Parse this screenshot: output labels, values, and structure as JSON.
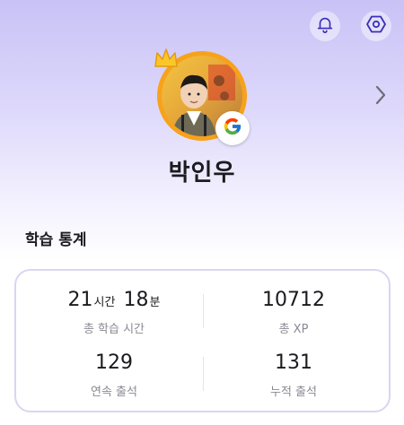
{
  "header": {
    "bell_icon": "bell-icon",
    "settings_icon": "hexagon-settings-icon",
    "next_icon": "chevron-right-icon"
  },
  "profile": {
    "name": "박인우",
    "login_provider_icon": "google-icon",
    "avatar_frame_color": "#f7a21a"
  },
  "stats_section": {
    "title": "학습 통계",
    "total_time": {
      "hours": "21",
      "hours_unit": "시간",
      "minutes": "18",
      "minutes_unit": "분",
      "label": "총 학습 시간"
    },
    "total_xp": {
      "value": "10712",
      "label": "총 XP"
    },
    "streak": {
      "value": "129",
      "label": "연속 출석"
    },
    "attendance": {
      "value": "131",
      "label": "누적 출석"
    }
  },
  "colors": {
    "accent": "#3b2fb8",
    "card_border": "#d9d5f3"
  }
}
